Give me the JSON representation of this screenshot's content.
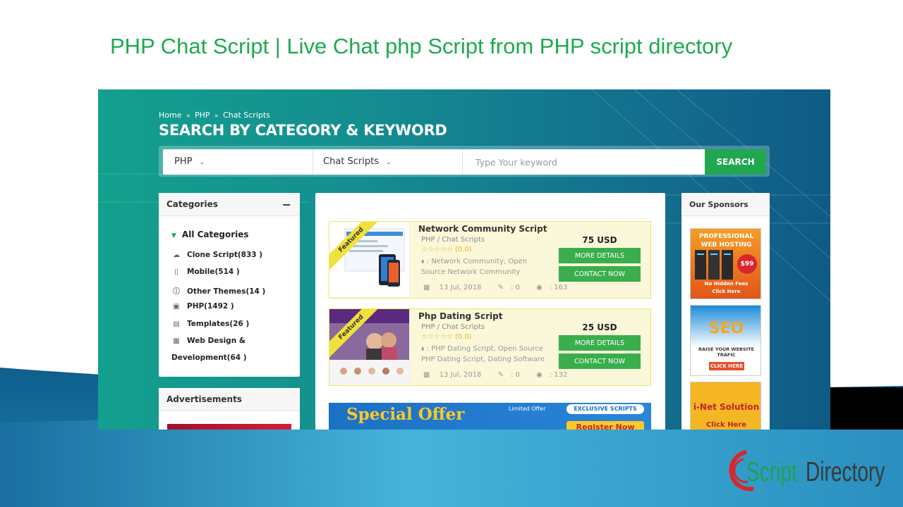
{
  "slide": {
    "title": "PHP Chat Script | Live Chat php Script from PHP script directory",
    "logo": {
      "word1": "Script",
      "word2": "Directory",
      "colors": {
        "ring": "#d8262c",
        "word1": "#1da251",
        "word2": "#3a3a3a"
      }
    }
  },
  "site": {
    "breadcrumb": [
      "Home",
      "PHP",
      "Chat Scripts"
    ],
    "breadcrumb_sep": "»",
    "heading": "SEARCH BY CATEGORY & KEYWORD",
    "search": {
      "category_select": "PHP",
      "subcategory_select": "Chat Scripts",
      "keyword_placeholder": "Type Your keyword",
      "button_label": "SEARCH"
    },
    "categories": {
      "title": "Categories",
      "collapse_symbol": "−",
      "all_label": "All Categories",
      "items": [
        {
          "label": "Clone Script(833 )",
          "icon": "cloud-icon"
        },
        {
          "label": "Mobile(514 )",
          "icon": "mobile-icon"
        },
        {
          "label": "Other Themes(14 )",
          "icon": "info-icon"
        },
        {
          "label": "PHP(1492 )",
          "icon": "php-icon"
        },
        {
          "label": "Templates(26 )",
          "icon": "document-icon"
        },
        {
          "label": "Web Design &",
          "label2": "Development(64 )",
          "icon": "printer-icon"
        }
      ]
    },
    "advertisements": {
      "title": "Advertisements"
    },
    "listings": [
      {
        "ribbon": "Featured",
        "title": "Network Community Script",
        "category": "PHP / Chat Scripts",
        "rating": "☆☆☆☆☆ (0.0)",
        "tags": ": Network Community, Open Source Network Community Script,",
        "date": "13 Jul, 2018",
        "reviews": ": 0",
        "views": ": 163",
        "price": "75 USD",
        "details_label": "MORE DETAILS",
        "contact_label": "CONTACT NOW"
      },
      {
        "ribbon": "Featured",
        "title": "Php Dating Script",
        "category": "PHP / Chat Scripts",
        "rating": "☆☆☆☆☆ (0.0)",
        "tags": ": PHP Dating Script, Open Source PHP Dating Script, Dating Software",
        "date": "13 Jul, 2018",
        "reviews": ": 0",
        "views": ": 132",
        "price": "25 USD",
        "details_label": "MORE DETAILS",
        "contact_label": "CONTACT NOW"
      }
    ],
    "offer_banner": {
      "headline": "Special Offer",
      "limited": "Limited Offer",
      "badge": "EXCLUSIVE SCRIPTS",
      "cta": "Register Now"
    },
    "sponsors": {
      "title": "Our Sponsors",
      "ads": [
        {
          "line1": "PROFESSIONAL",
          "line2": "WEB HOSTING",
          "price": "$99",
          "sub": "No Hidden Fees",
          "cta": "Click Here"
        },
        {
          "line1": "SEO",
          "line2": "RAISE YOUR WEBSITE TRAFIC",
          "cta": "CLICK HERE"
        },
        {
          "line1": "i-Net Solution",
          "cta": "Click Here"
        }
      ]
    }
  }
}
